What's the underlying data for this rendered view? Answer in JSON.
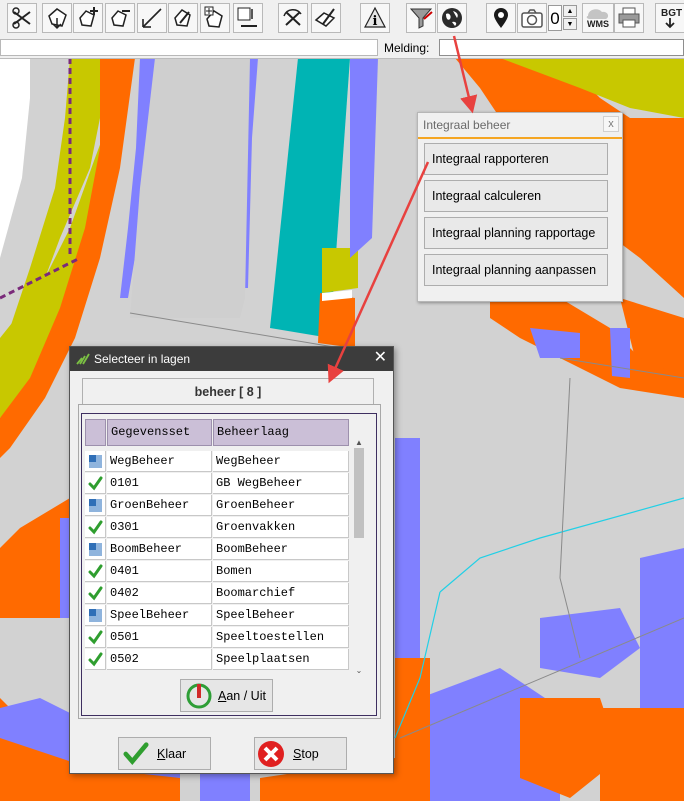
{
  "toolbar": {
    "buttons": [
      {
        "name": "scissors-tool-icon"
      },
      {
        "name": "polygon-select-icon"
      },
      {
        "name": "polygon-add-icon"
      },
      {
        "name": "polygon-remove-icon"
      },
      {
        "name": "line-angle-icon"
      },
      {
        "name": "edit-pencil-icon"
      },
      {
        "name": "polygon-plus-icon"
      },
      {
        "name": "text-tool-icon"
      },
      {
        "name": "undo-scissors-icon"
      },
      {
        "name": "layer-edit-icon"
      },
      {
        "name": "info-icon"
      },
      {
        "name": "funnel-filter-icon"
      },
      {
        "name": "integraal-globe-icon"
      },
      {
        "name": "map-pin-icon"
      },
      {
        "name": "camera-icon"
      }
    ],
    "spinner_value": "0",
    "wms_label": "WMS",
    "bgt_label": "BGT"
  },
  "status": {
    "melding_label": "Melding:",
    "melding_value": ""
  },
  "integraal_popup": {
    "title": "Integraal beheer",
    "close_label": "x",
    "items": [
      {
        "label": "Integraal rapporteren"
      },
      {
        "label": "Integraal calculeren"
      },
      {
        "label": "Integraal planning rapportage"
      },
      {
        "label": "Integraal planning aanpassen"
      }
    ]
  },
  "select_dialog": {
    "title": "Selecteer in lagen",
    "close_label": "✕",
    "tab_label": "beheer [ 8 ]",
    "columns": [
      "Gegevensset",
      "Beheerlaag"
    ],
    "rows": [
      {
        "icon": "group",
        "dataset": "WegBeheer",
        "layer": "WegBeheer"
      },
      {
        "icon": "check",
        "dataset": "0101",
        "layer": "GB WegBeheer"
      },
      {
        "icon": "group",
        "dataset": "GroenBeheer",
        "layer": "GroenBeheer"
      },
      {
        "icon": "check",
        "dataset": "0301",
        "layer": "Groenvakken"
      },
      {
        "icon": "group",
        "dataset": "BoomBeheer",
        "layer": "BoomBeheer"
      },
      {
        "icon": "check",
        "dataset": "0401",
        "layer": "Bomen"
      },
      {
        "icon": "check",
        "dataset": "0402",
        "layer": "Boomarchief"
      },
      {
        "icon": "group",
        "dataset": "SpeelBeheer",
        "layer": "SpeelBeheer"
      },
      {
        "icon": "check",
        "dataset": "0501",
        "layer": "Speeltoestellen"
      },
      {
        "icon": "check",
        "dataset": "0502",
        "layer": "Speelplaatsen"
      }
    ],
    "toggle_button": {
      "mnemonic": "A",
      "rest": "an / Uit"
    },
    "ok_button": {
      "mnemonic": "K",
      "rest": "laar"
    },
    "stop_button": {
      "mnemonic": "S",
      "rest": "top"
    }
  },
  "colors": {
    "map_background": "#d2d2d2",
    "map_white": "#ffffff",
    "map_olive": "#c8c800",
    "map_orange": "#ff6a00",
    "map_purple": "#8080ff",
    "map_teal": "#00b4b4",
    "annotation_arrow": "#e8413f",
    "accent_orange": "#f5a623",
    "check_green": "#2f9e2f",
    "header_lavender": "#cbbfd7"
  }
}
